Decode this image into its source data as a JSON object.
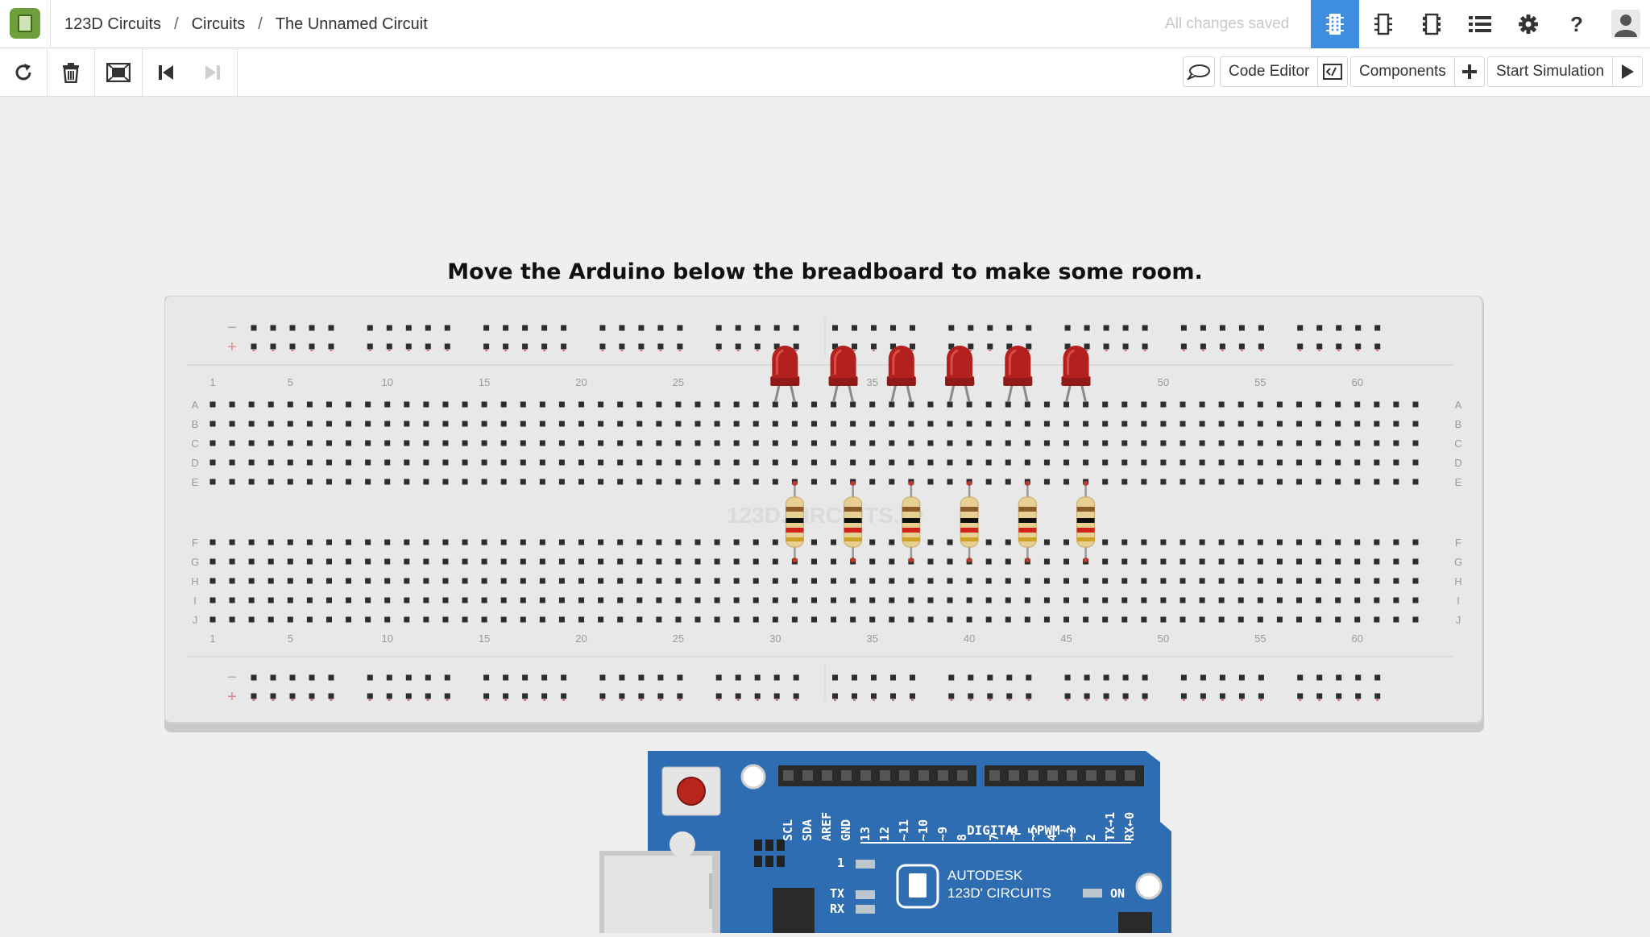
{
  "header": {
    "breadcrumbs": [
      "123D Circuits",
      "Circuits",
      "The Unnamed Circuit"
    ],
    "save_status": "All changes saved",
    "icons": [
      "breadboard-view-icon",
      "schematic-view-icon",
      "pcb-view-icon",
      "list-view-icon",
      "gear-icon",
      "help-icon",
      "user-avatar-icon"
    ]
  },
  "toolbar": {
    "left_icons": [
      "rotate-icon",
      "trash-icon",
      "fit-to-screen-icon",
      "step-back-icon",
      "step-forward-icon"
    ],
    "comment_icon": "comment-icon",
    "code_editor_label": "Code Editor",
    "components_label": "Components",
    "start_simulation_label": "Start Simulation"
  },
  "canvas": {
    "instruction": "Move the Arduino below the breadboard to make some room.",
    "breadboard": {
      "watermark": "123D.CIRCUITS.IO",
      "rail_minus": "−",
      "rail_plus": "+",
      "column_numbers": [
        "1",
        "5",
        "10",
        "15",
        "20",
        "25",
        "30",
        "35",
        "40",
        "45",
        "50",
        "55",
        "60"
      ],
      "row_letters": [
        "A",
        "B",
        "C",
        "D",
        "E",
        "F",
        "G",
        "H",
        "I",
        "J"
      ],
      "led_count": 6,
      "resistor_count": 6,
      "led_color": "#b3211e"
    },
    "arduino": {
      "header_labels": [
        "SCL",
        "SDA",
        "AREF",
        "GND",
        "13",
        "12",
        "~11",
        "~10",
        "~9",
        "8",
        "7",
        "~6",
        "~5",
        "4",
        "~3",
        "2",
        "TX→1",
        "RX←0"
      ],
      "digital_label": "DIGITAL (PWM~)",
      "brand_line1": "AUTODESK",
      "brand_line2": "123D' CIRCUITS",
      "on_label": "ON",
      "tx_label": "TX",
      "rx_label": "RX",
      "l_label": "1",
      "board_color": "#2f6db3"
    }
  }
}
